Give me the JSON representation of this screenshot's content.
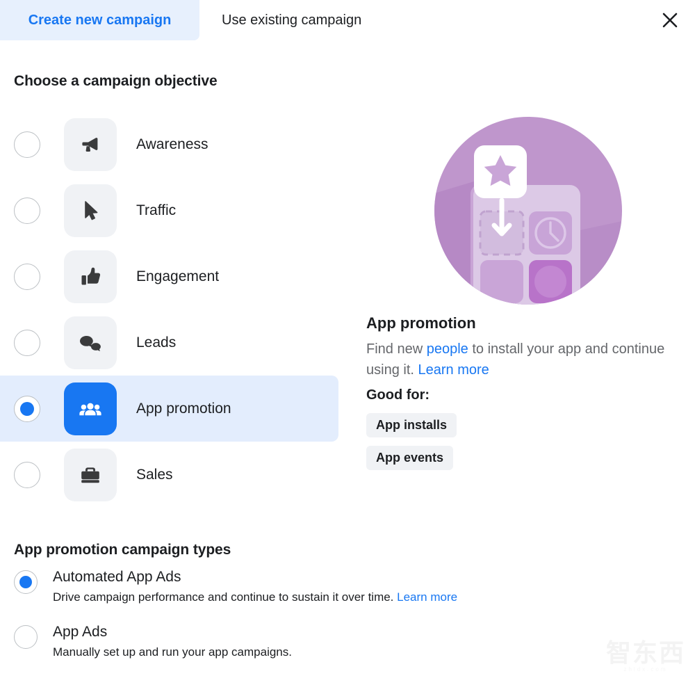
{
  "tabs": [
    {
      "label": "Create new campaign",
      "active": true
    },
    {
      "label": "Use existing campaign",
      "active": false
    }
  ],
  "close_icon": "close-icon",
  "objective_section": {
    "title": "Choose a campaign objective",
    "options": [
      {
        "label": "Awareness",
        "icon": "megaphone-icon",
        "selected": false
      },
      {
        "label": "Traffic",
        "icon": "cursor-icon",
        "selected": false
      },
      {
        "label": "Engagement",
        "icon": "thumbs-up-icon",
        "selected": false
      },
      {
        "label": "Leads",
        "icon": "speech-bubbles-icon",
        "selected": false
      },
      {
        "label": "App promotion",
        "icon": "people-group-icon",
        "selected": true
      },
      {
        "label": "Sales",
        "icon": "briefcase-icon",
        "selected": false
      }
    ]
  },
  "detail": {
    "illustration": "app-promotion-illustration",
    "title": "App promotion",
    "desc_part1": "Find new ",
    "desc_link1": "people",
    "desc_part2": " to install your app and continue using it. ",
    "desc_link2": "Learn more",
    "good_for_label": "Good for:",
    "tags": [
      "App installs",
      "App events"
    ]
  },
  "types_section": {
    "title": "App promotion campaign types",
    "options": [
      {
        "label": "Automated App Ads",
        "desc": "Drive campaign performance and continue to sustain it over time. ",
        "link": "Learn more",
        "selected": true
      },
      {
        "label": "App Ads",
        "desc": "Manually set up and run your app campaigns.",
        "link": "",
        "selected": false
      }
    ]
  },
  "watermark": {
    "main": "智东西",
    "sub": "zhidx.com"
  },
  "colors": {
    "accent": "#1877F2",
    "tab_active_bg": "#E7F0FD",
    "row_selected_bg": "#E3EDFD",
    "tile_bg": "#F0F2F5",
    "text_primary": "#1c1e21",
    "text_secondary": "#65676b",
    "illustration_circle": "#BF96CC"
  }
}
